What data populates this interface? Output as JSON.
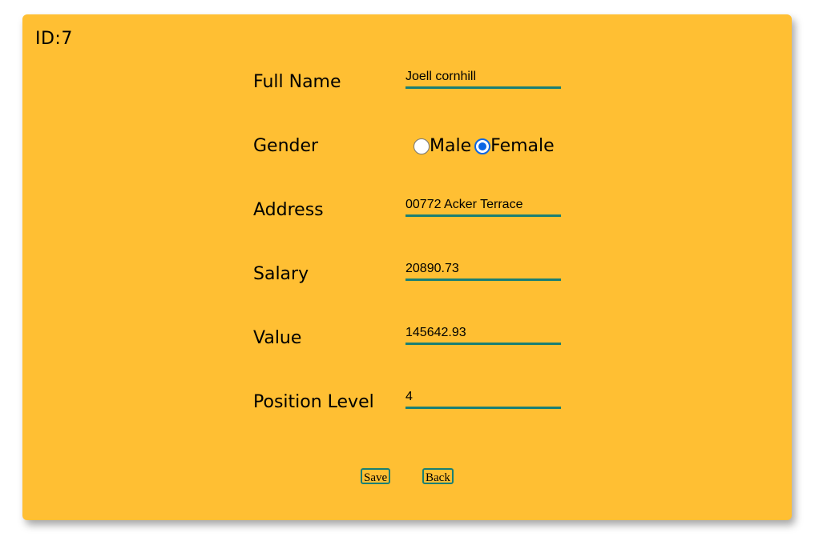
{
  "record": {
    "id_label": "ID:7"
  },
  "form": {
    "full_name": {
      "label": "Full Name",
      "value": "Joell cornhill"
    },
    "gender": {
      "label": "Gender",
      "options": [
        {
          "label": "Male",
          "checked": false
        },
        {
          "label": "Female",
          "checked": true
        }
      ]
    },
    "address": {
      "label": "Address",
      "value": "00772 Acker Terrace"
    },
    "salary": {
      "label": "Salary",
      "value": "20890.73"
    },
    "value": {
      "label": "Value",
      "value": "145642.93"
    },
    "position_level": {
      "label": "Position Level",
      "value": "4"
    }
  },
  "actions": {
    "save_label": "Save",
    "back_label": "Back"
  },
  "colors": {
    "card_background": "#ffbf33",
    "accent_underline": "#1a7f74",
    "radio_selected": "#0b66e4"
  }
}
